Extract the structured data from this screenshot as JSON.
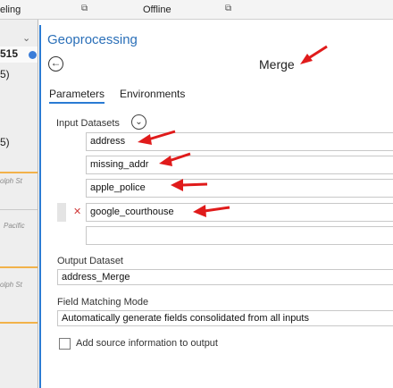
{
  "topbar": {
    "tab_fragment": "eling",
    "offline_label": "Offline"
  },
  "map": {
    "label_top": "515",
    "label_paren": "5)",
    "label_paren2": "5)",
    "road_labels": [
      "olph St",
      "Pacific",
      "olph St"
    ]
  },
  "pane": {
    "title": "Geoprocessing",
    "tool_name": "Merge",
    "tabs": [
      "Parameters",
      "Environments"
    ],
    "input_datasets_label": "Input Datasets",
    "input_datasets": [
      "address",
      "missing_addr",
      "apple_police",
      "google_courthouse"
    ],
    "input_placeholder": "",
    "output_dataset_label": "Output Dataset",
    "output_dataset_value": "address_Merge",
    "field_matching_label": "Field Matching Mode",
    "field_matching_value": "Automatically generate fields consolidated from all inputs",
    "add_source_label": "Add source information to output",
    "add_source_checked": false
  },
  "colors": {
    "accent": "#2a7bd3",
    "arrow": "#e01b1b",
    "road": "#f2b24a"
  }
}
